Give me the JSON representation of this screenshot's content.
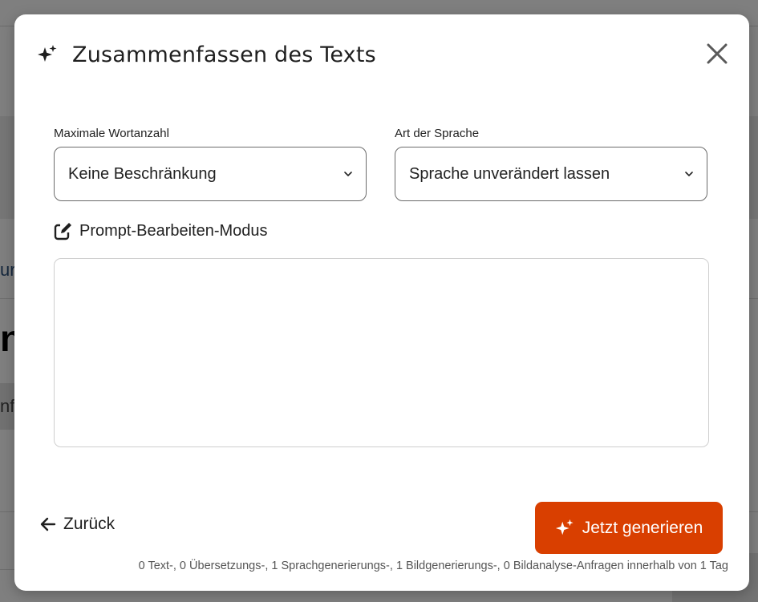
{
  "background": {
    "partial_text_a": "ur",
    "partial_text_b": "n",
    "partial_text_c": "nfa"
  },
  "modal": {
    "title": "Zusammenfassen des Texts",
    "title_icon": "sparkle-icon",
    "close_icon": "close-icon"
  },
  "fields": {
    "max_words": {
      "label": "Maximale Wortanzahl",
      "value": "Keine Beschränkung"
    },
    "language_type": {
      "label": "Art der Sprache",
      "value": "Sprache unverändert lassen"
    }
  },
  "prompt_mode": {
    "label": "Prompt-Bearbeiten-Modus",
    "icon": "edit-icon",
    "text": ""
  },
  "footer": {
    "back_label": "Zurück",
    "generate_label": "Jetzt generieren",
    "quota_text": "0 Text-, 0 Übersetzungs-, 1 Sprachgenerierungs-, 1 Bildgenerierungs-, 0 Bildanalyse-Anfragen innerhalb von 1 Tag"
  },
  "colors": {
    "accent": "#d93f00",
    "overlay": "rgba(0,0,0,0.5)"
  }
}
